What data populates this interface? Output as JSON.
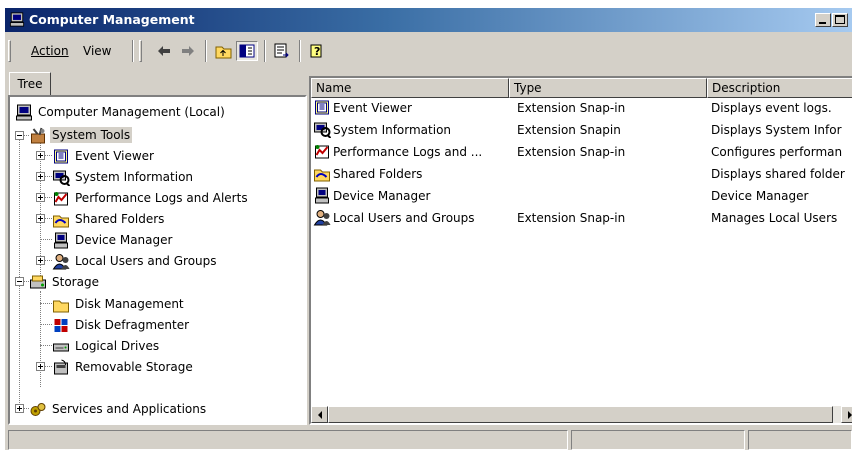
{
  "window": {
    "title": "Computer Management"
  },
  "menu": {
    "action": "Action",
    "view": "View"
  },
  "tree": {
    "tab_label": "Tree",
    "items": [
      {
        "label": "Computer Management (Local)"
      },
      {
        "label": "System Tools"
      },
      {
        "label": "Event Viewer"
      },
      {
        "label": "System Information"
      },
      {
        "label": "Performance Logs and Alerts"
      },
      {
        "label": "Shared Folders"
      },
      {
        "label": "Device Manager"
      },
      {
        "label": "Local Users and Groups"
      },
      {
        "label": "Storage"
      },
      {
        "label": "Disk Management"
      },
      {
        "label": "Disk Defragmenter"
      },
      {
        "label": "Logical Drives"
      },
      {
        "label": "Removable Storage"
      },
      {
        "label": "Services and Applications"
      }
    ],
    "selected": "System Tools"
  },
  "list": {
    "columns": {
      "name": "Name",
      "type": "Type",
      "description": "Description"
    },
    "rows": [
      {
        "name": "Event Viewer",
        "type": "Extension Snap-in",
        "description": "Displays event logs."
      },
      {
        "name": "System Information",
        "type": "Extension Snapin",
        "description": "Displays System Infor"
      },
      {
        "name": "Performance Logs and ...",
        "type": "Extension Snap-in",
        "description": "Configures performan"
      },
      {
        "name": "Shared Folders",
        "type": "",
        "description": "Displays shared folder"
      },
      {
        "name": "Device Manager",
        "type": "",
        "description": "Device Manager"
      },
      {
        "name": "Local Users and Groups",
        "type": "Extension Snap-in",
        "description": "Manages Local Users"
      }
    ]
  },
  "colors": {
    "titlebar_start": "#0a246a",
    "titlebar_end": "#a6caf0",
    "face": "#d4d0c8"
  }
}
